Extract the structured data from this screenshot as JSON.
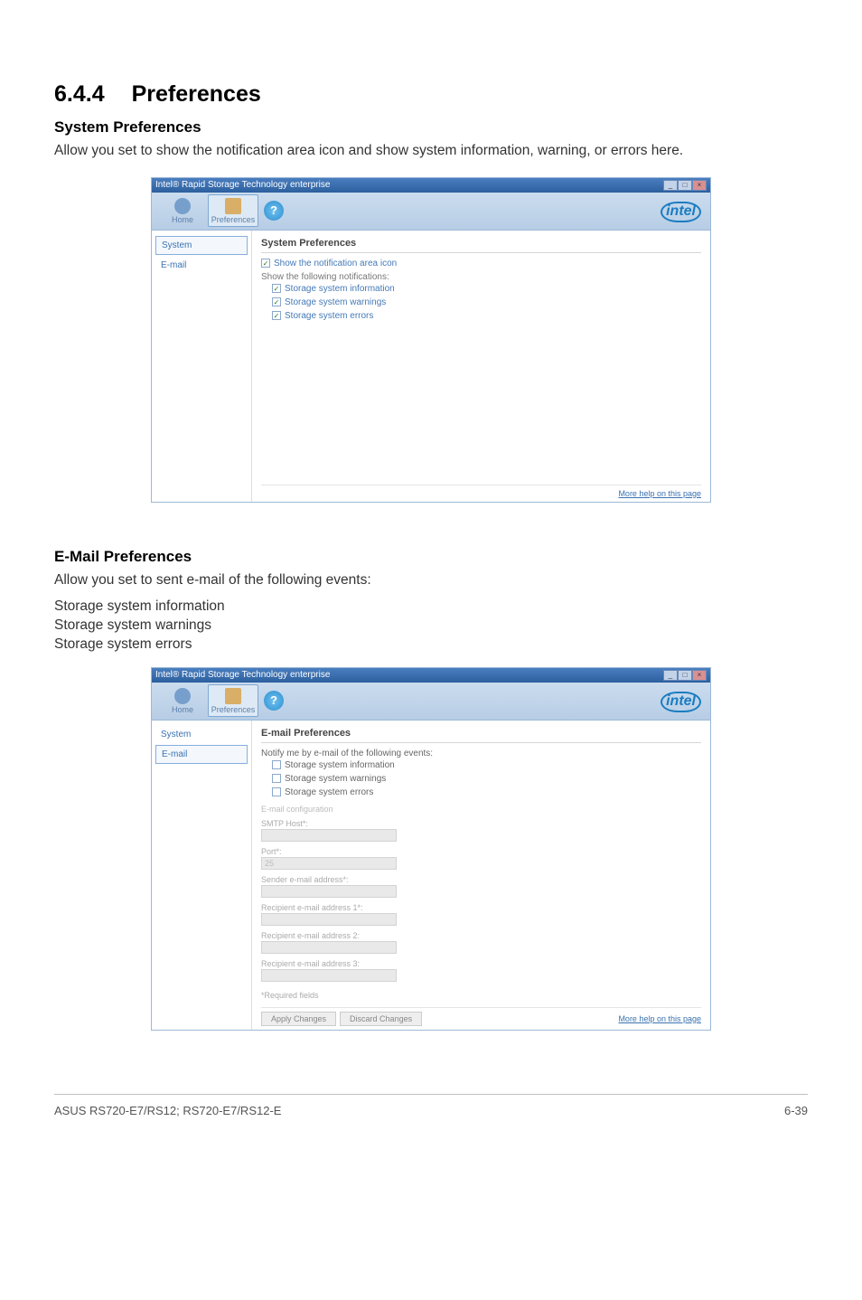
{
  "heading": {
    "number": "6.4.4",
    "title": "Preferences"
  },
  "systemPrefs": {
    "heading": "System Preferences",
    "body": "Allow you set to show the notification area icon and show system information, warning, or errors here."
  },
  "emailPrefs": {
    "heading": "E-Mail Preferences",
    "body": "Allow you set to sent e-mail of the following events:",
    "lines": {
      "l1": "Storage system information",
      "l2": "Storage system warnings",
      "l3": "Storage system errors"
    }
  },
  "app": {
    "title": "Intel® Rapid Storage Technology enterprise",
    "toolbar": {
      "home": "Home",
      "preferences": "Preferences",
      "help_glyph": "?"
    },
    "intel": "intel",
    "side": {
      "system": "System",
      "email": "E-mail"
    },
    "winbtn": {
      "min": "_",
      "max": "□",
      "close": "×"
    },
    "moreHelp": "More help on this page"
  },
  "panelSystem": {
    "title": "System Preferences",
    "showIcon": "Show the notification area icon",
    "showFollowing": "Show the following notifications:",
    "info": "Storage system information",
    "warn": "Storage system warnings",
    "err": "Storage system errors",
    "check": "✓"
  },
  "panelEmail": {
    "title": "E-mail Preferences",
    "notifyLine": "Notify me by e-mail of the following events:",
    "info": "Storage system information",
    "warn": "Storage system warnings",
    "err": "Storage system errors",
    "configLabel": "E-mail configuration",
    "smtp": "SMTP Host*:",
    "port": "Port*:",
    "portValue": "25",
    "sender": "Sender e-mail address*:",
    "r1": "Recipient e-mail address 1*:",
    "r2": "Recipient e-mail address 2:",
    "r3": "Recipient e-mail address 3:",
    "required": "*Required fields",
    "apply": "Apply Changes",
    "discard": "Discard Changes"
  },
  "footer": {
    "left": "ASUS RS720-E7/RS12; RS720-E7/RS12-E",
    "right": "6-39"
  }
}
